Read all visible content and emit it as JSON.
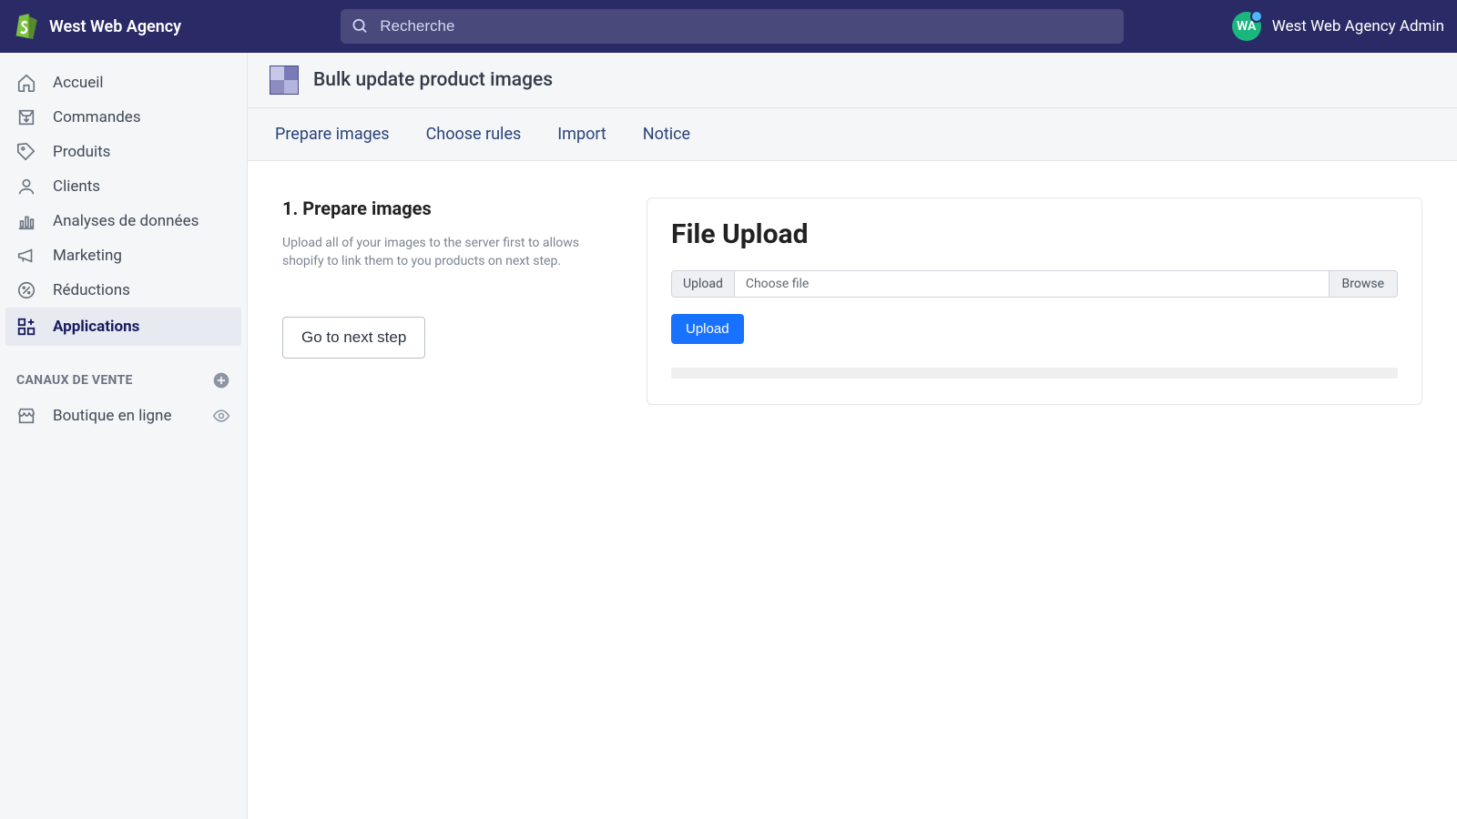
{
  "header": {
    "shop_name": "West Web Agency",
    "search_placeholder": "Recherche",
    "avatar_initials": "WA",
    "admin_name": "West Web Agency Admin"
  },
  "sidebar": {
    "items": [
      {
        "label": "Accueil"
      },
      {
        "label": "Commandes"
      },
      {
        "label": "Produits"
      },
      {
        "label": "Clients"
      },
      {
        "label": "Analyses de données"
      },
      {
        "label": "Marketing"
      },
      {
        "label": "Réductions"
      },
      {
        "label": "Applications"
      }
    ],
    "channels_header": "CANAUX DE VENTE",
    "channels": [
      {
        "label": "Boutique en ligne"
      }
    ]
  },
  "app": {
    "title": "Bulk update product images",
    "tabs": [
      {
        "label": "Prepare images"
      },
      {
        "label": "Choose rules"
      },
      {
        "label": "Import"
      },
      {
        "label": "Notice"
      }
    ]
  },
  "step": {
    "title": "1. Prepare images",
    "description": "Upload all of your images to the server first to allows shopify to link them to you products on next step.",
    "next_button": "Go to next step"
  },
  "upload_card": {
    "heading": "File Upload",
    "label": "Upload",
    "choose_text": "Choose file",
    "browse": "Browse",
    "button": "Upload"
  }
}
